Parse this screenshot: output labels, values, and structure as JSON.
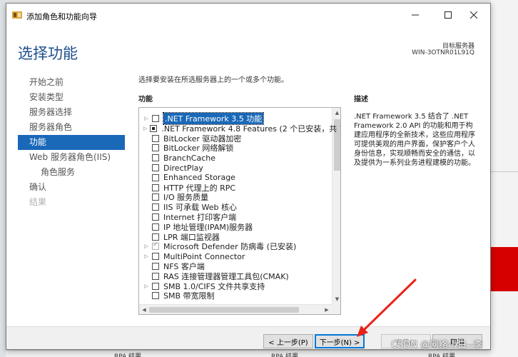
{
  "window": {
    "title": "添加角色和功能向导",
    "page_title": "选择功能",
    "dest_label": "目标服务器",
    "dest_server": "WIN-3OTNR01L91Q"
  },
  "nav": {
    "items": [
      {
        "label": "开始之前",
        "state": "normal"
      },
      {
        "label": "安装类型",
        "state": "normal"
      },
      {
        "label": "服务器选择",
        "state": "normal"
      },
      {
        "label": "服务器角色",
        "state": "normal"
      },
      {
        "label": "功能",
        "state": "active"
      },
      {
        "label": "Web 服务器角色(IIS)",
        "state": "normal"
      },
      {
        "label": "角色服务",
        "state": "sub"
      },
      {
        "label": "确认",
        "state": "normal"
      },
      {
        "label": "结果",
        "state": "disabled"
      }
    ]
  },
  "main": {
    "instruction": "选择要安装在所选服务器上的一个或多个功能。",
    "features_header": "功能",
    "description_header": "描述",
    "description": ".NET Framework 3.5 结合了 .NET Framework 2.0 API 的功能和用于构建应用程序的全新技术，这些应用程序可提供美观的用户界面，保护客户个人身份信息，实现顺畅而安全的通信，以及提供为一系列业务进程建模的功能。",
    "features": [
      {
        "label": ".NET Framework 3.5 功能",
        "expandable": true,
        "check": "none",
        "selected": true
      },
      {
        "label": ".NET Framework 4.8 Features (2 个已安装，共 7",
        "expandable": true,
        "check": "partial",
        "selected": false
      },
      {
        "label": "BitLocker 驱动器加密",
        "expandable": false,
        "check": "none",
        "selected": false
      },
      {
        "label": "BitLocker 网络解锁",
        "expandable": false,
        "check": "none",
        "selected": false
      },
      {
        "label": "BranchCache",
        "expandable": false,
        "check": "none",
        "selected": false
      },
      {
        "label": "DirectPlay",
        "expandable": false,
        "check": "none",
        "selected": false
      },
      {
        "label": "Enhanced Storage",
        "expandable": false,
        "check": "none",
        "selected": false
      },
      {
        "label": "HTTP 代理上的 RPC",
        "expandable": false,
        "check": "none",
        "selected": false
      },
      {
        "label": "I/O 服务质量",
        "expandable": false,
        "check": "none",
        "selected": false
      },
      {
        "label": "IIS 可承载 Web 核心",
        "expandable": false,
        "check": "none",
        "selected": false
      },
      {
        "label": "Internet 打印客户端",
        "expandable": false,
        "check": "none",
        "selected": false
      },
      {
        "label": "IP 地址管理(IPAM)服务器",
        "expandable": false,
        "check": "none",
        "selected": false
      },
      {
        "label": "LPR 端口监视器",
        "expandable": false,
        "check": "none",
        "selected": false
      },
      {
        "label": "Microsoft Defender 防病毒 (已安装)",
        "expandable": true,
        "check": "installed",
        "selected": false
      },
      {
        "label": "MultiPoint Connector",
        "expandable": true,
        "check": "none",
        "selected": false
      },
      {
        "label": "NFS 客户端",
        "expandable": false,
        "check": "none",
        "selected": false
      },
      {
        "label": "RAS 连接管理器管理工具包(CMAK)",
        "expandable": false,
        "check": "none",
        "selected": false
      },
      {
        "label": "SMB 1.0/CIFS 文件共享支持",
        "expandable": true,
        "check": "none",
        "selected": false
      },
      {
        "label": "SMB 带宽限制",
        "expandable": false,
        "check": "none",
        "selected": false
      }
    ]
  },
  "footer": {
    "prev": "< 上一步(P)",
    "next": "下一步(N) >",
    "install": "安装(I)",
    "cancel": "取消"
  },
  "background": {
    "bottom_labels": [
      "RPA 结果",
      "RPA 结果",
      "RPA 结果"
    ]
  },
  "watermark": "CSDN @网络小白--李",
  "colors": {
    "accent": "#1a68b8",
    "title": "#1c4d8c",
    "annotation_arrow": "#e8231b"
  }
}
